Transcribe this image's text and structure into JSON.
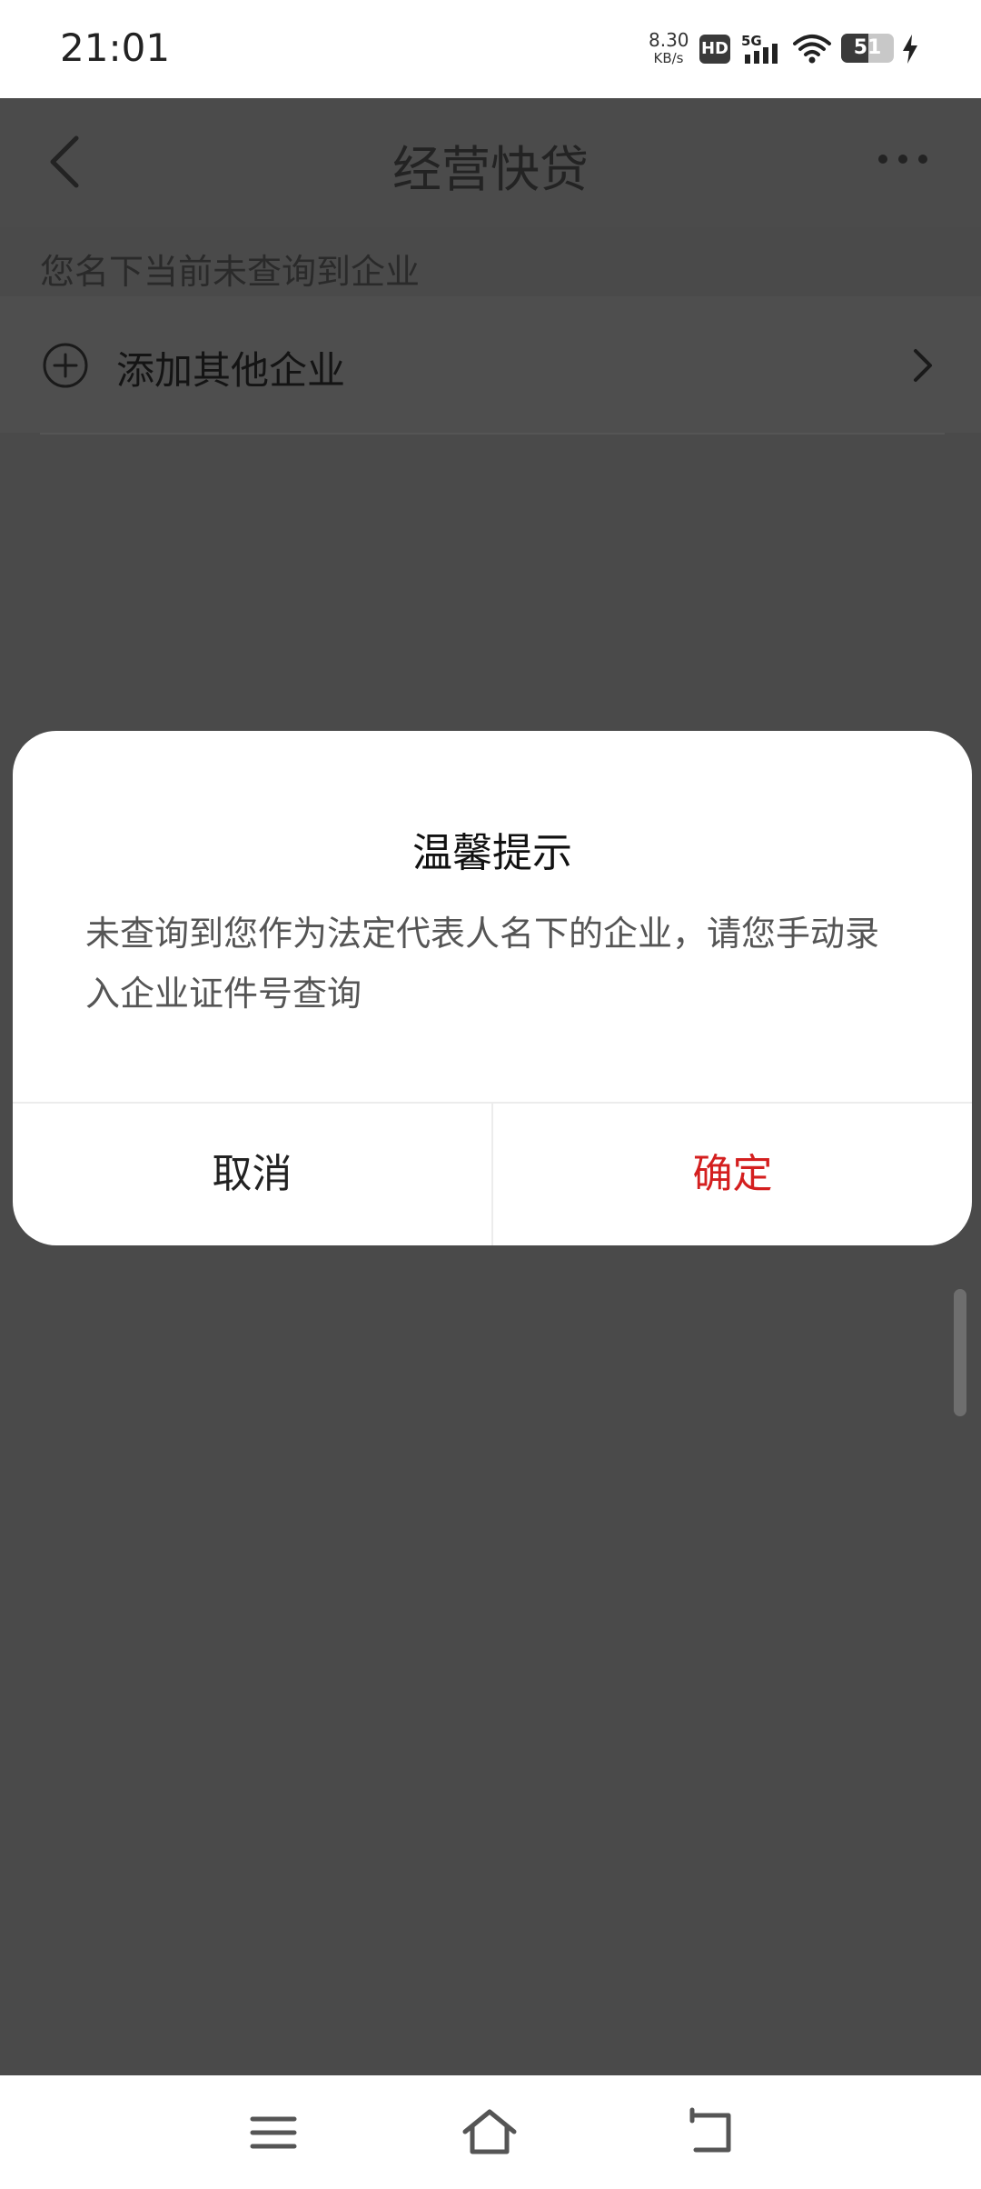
{
  "status_bar": {
    "time": "21:01",
    "net_speed_value": "8.30",
    "net_speed_unit": "KB/s",
    "hd_label": "HD",
    "network_type": "5G",
    "battery_level": "51",
    "battery_fraction": 0.51
  },
  "header": {
    "title": "经营快贷"
  },
  "content": {
    "hint": "您名下当前未查询到企业",
    "add_company_label": "添加其他企业"
  },
  "dialog": {
    "title": "温馨提示",
    "message": "未查询到您作为法定代表人名下的企业，请您手动录入企业证件号查询",
    "cancel_label": "取消",
    "confirm_label": "确定"
  },
  "colors": {
    "accent": "#d41f1f",
    "overlay": "#4a4a4a",
    "dialog_bg": "#ffffff"
  }
}
